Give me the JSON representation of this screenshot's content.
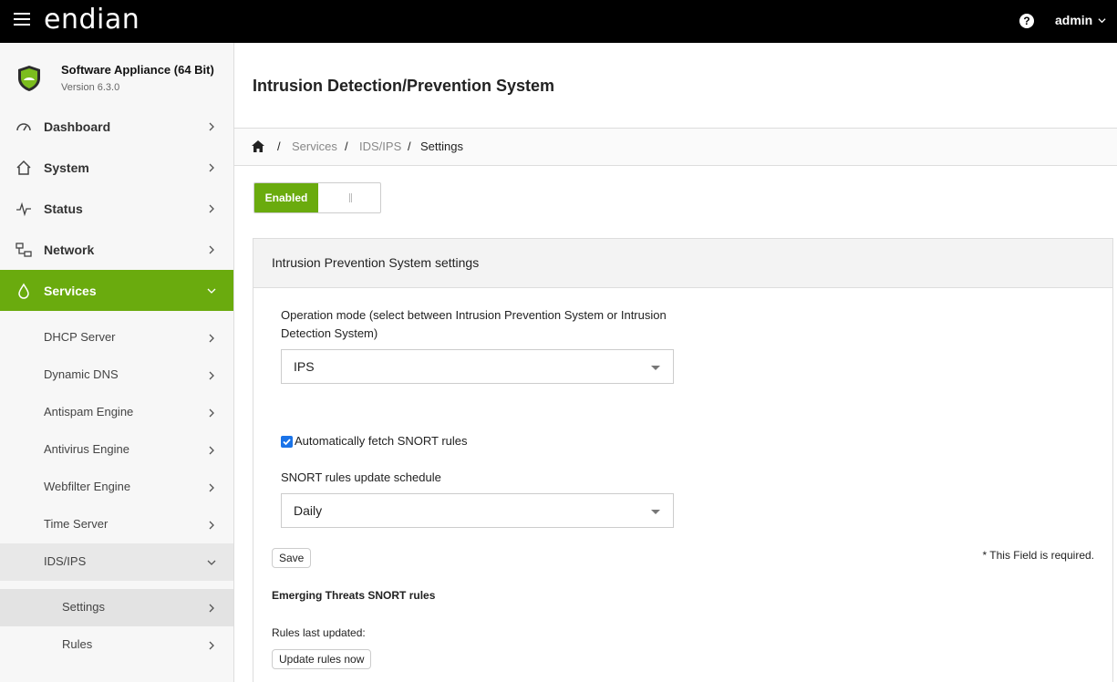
{
  "header": {
    "logo": "endian",
    "help": "?",
    "user": "admin"
  },
  "sidebar": {
    "app_title": "Software Appliance (64 Bit)",
    "app_version": "Version 6.3.0",
    "items": [
      {
        "label": "Dashboard",
        "icon": "gauge-icon"
      },
      {
        "label": "System",
        "icon": "home-icon"
      },
      {
        "label": "Status",
        "icon": "pulse-icon"
      },
      {
        "label": "Network",
        "icon": "network-icon"
      },
      {
        "label": "Services",
        "icon": "drop-icon"
      }
    ],
    "services_sub": [
      {
        "label": "DHCP Server"
      },
      {
        "label": "Dynamic DNS"
      },
      {
        "label": "Antispam Engine"
      },
      {
        "label": "Antivirus Engine"
      },
      {
        "label": "Webfilter Engine"
      },
      {
        "label": "Time Server"
      },
      {
        "label": "IDS/IPS"
      }
    ],
    "ids_sub": [
      {
        "label": "Settings"
      },
      {
        "label": "Rules"
      }
    ],
    "accent": "#6aab0e"
  },
  "main": {
    "title": "Intrusion Detection/Prevention System",
    "breadcrumb": {
      "sep": "/",
      "items": [
        "Services",
        "IDS/IPS",
        "Settings"
      ]
    },
    "toggle_label": "Enabled",
    "panel": {
      "title": "Intrusion Prevention System settings",
      "operation_label_1": "Operation mode (select between Intrusion Prevention System or Intrusion",
      "operation_label_2": "Detection System)",
      "operation_value": "IPS",
      "auto_fetch_label": "Automatically fetch SNORT rules",
      "auto_fetch_checked": true,
      "schedule_label": "SNORT rules update schedule",
      "schedule_value": "Daily",
      "save_label": "Save",
      "required_note": "* This Field is required.",
      "emerging_title": "Emerging Threats SNORT rules",
      "last_updated_label": "Rules last updated:",
      "update_button": "Update rules now"
    }
  }
}
